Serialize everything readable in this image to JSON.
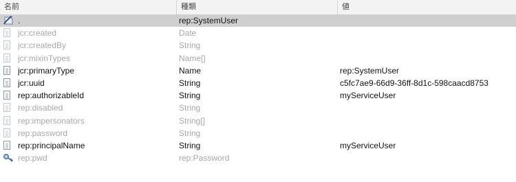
{
  "columns": {
    "name": "名前",
    "type": "種類",
    "value": "値"
  },
  "rows": [
    {
      "name": ".",
      "type": "rep:SystemUser",
      "value": "",
      "icon": "node-icon",
      "dim": false,
      "selected": true
    },
    {
      "name": "jcr:created",
      "type": "Date",
      "value": "",
      "icon": "property-icon",
      "dim": true,
      "selected": false
    },
    {
      "name": "jcr:createdBy",
      "type": "String",
      "value": "",
      "icon": "property-icon",
      "dim": true,
      "selected": false
    },
    {
      "name": "jcr:mixinTypes",
      "type": "Name[]",
      "value": "",
      "icon": "property-icon",
      "dim": true,
      "selected": false
    },
    {
      "name": "jcr:primaryType",
      "type": "Name",
      "value": "rep:SystemUser",
      "icon": "property-icon",
      "dim": false,
      "selected": false
    },
    {
      "name": "jcr:uuid",
      "type": "String",
      "value": "c5fc7ae9-66d9-36ff-8d1c-598caacd8753",
      "icon": "property-icon",
      "dim": false,
      "selected": false
    },
    {
      "name": "rep:authorizableId",
      "type": "String",
      "value": "myServiceUser",
      "icon": "property-icon",
      "dim": false,
      "selected": false
    },
    {
      "name": "rep:disabled",
      "type": "String",
      "value": "",
      "icon": "property-icon",
      "dim": true,
      "selected": false
    },
    {
      "name": "rep:impersonators",
      "type": "String[]",
      "value": "",
      "icon": "property-icon",
      "dim": true,
      "selected": false
    },
    {
      "name": "rep:password",
      "type": "String",
      "value": "",
      "icon": "property-icon",
      "dim": true,
      "selected": false
    },
    {
      "name": "rep:principalName",
      "type": "String",
      "value": "myServiceUser",
      "icon": "property-icon",
      "dim": false,
      "selected": false
    },
    {
      "name": "rep:pwd",
      "type": "rep:Password",
      "value": "",
      "icon": "key-icon",
      "dim": true,
      "selected": false
    }
  ]
}
